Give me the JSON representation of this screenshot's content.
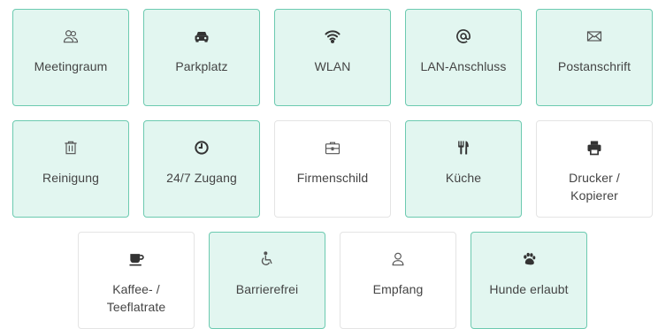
{
  "amenities": [
    {
      "label": "Meetingraum",
      "icon": "group-icon",
      "selected": true
    },
    {
      "label": "Parkplatz",
      "icon": "car-icon",
      "selected": true
    },
    {
      "label": "WLAN",
      "icon": "wifi-icon",
      "selected": true
    },
    {
      "label": "LAN-Anschluss",
      "icon": "at-sign-icon",
      "selected": true
    },
    {
      "label": "Postanschrift",
      "icon": "envelope-icon",
      "selected": true
    },
    {
      "label": "Reinigung",
      "icon": "trash-icon",
      "selected": true
    },
    {
      "label": "24/7 Zugang",
      "icon": "clock-icon",
      "selected": true
    },
    {
      "label": "Firmenschild",
      "icon": "briefcase-icon",
      "selected": false
    },
    {
      "label": "Küche",
      "icon": "cutlery-icon",
      "selected": true
    },
    {
      "label": "Drucker / Kopierer",
      "icon": "printer-icon",
      "selected": false
    },
    {
      "label": "Kaffee- / Teeflatrate",
      "icon": "coffee-cup-icon",
      "selected": false
    },
    {
      "label": "Barrierefrei",
      "icon": "wheelchair-icon",
      "selected": true
    },
    {
      "label": "Empfang",
      "icon": "person-icon",
      "selected": false
    },
    {
      "label": "Hunde erlaubt",
      "icon": "paw-icon",
      "selected": true
    }
  ],
  "colors": {
    "selected_bg": "#e2f6f0",
    "selected_border": "#6ccab0",
    "unselected_bg": "#ffffff",
    "unselected_border": "#e4e4e4",
    "text": "#444444"
  }
}
